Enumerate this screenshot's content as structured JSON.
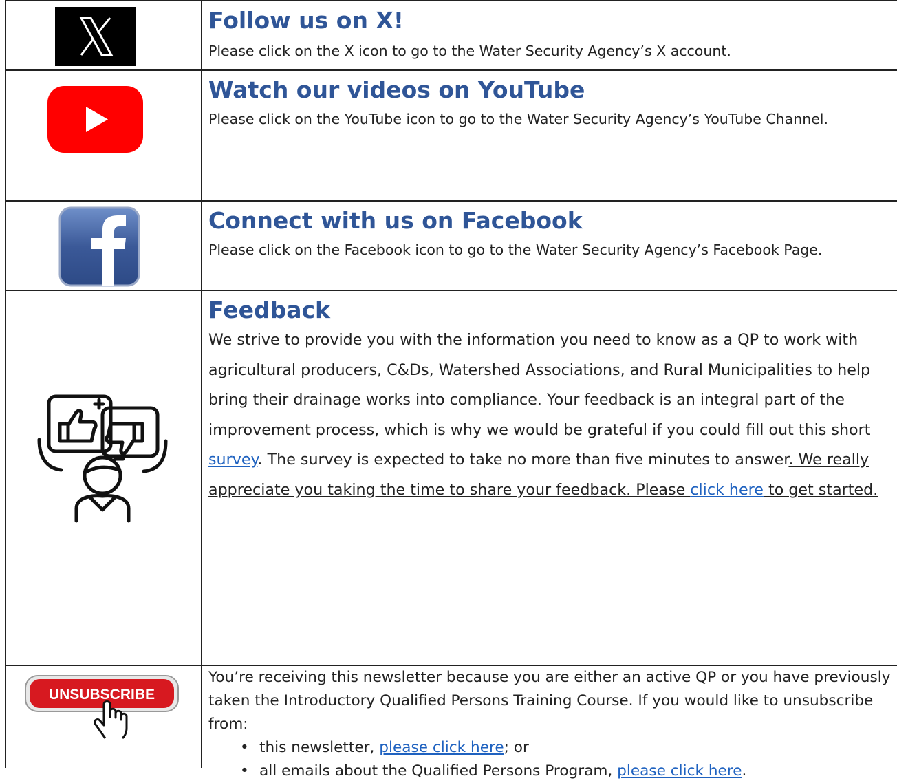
{
  "rows": {
    "x": {
      "icon": "x-logo-icon",
      "heading": "Follow us on X!",
      "text": "Please click on the X icon to go to the Water Security Agency’s X account."
    },
    "youtube": {
      "icon": "youtube-logo-icon",
      "heading": "Watch our videos on YouTube",
      "text": "Please click on the YouTube icon to go to the Water Security Agency’s YouTube Channel."
    },
    "facebook": {
      "icon": "facebook-logo-icon",
      "heading": "Connect with us on Facebook",
      "text": "Please click on the Facebook icon to go to the Water Security Agency’s Facebook Page."
    },
    "feedback": {
      "icon": "feedback-thumbs-icon",
      "heading": "Feedback",
      "text_1": "We strive to provide you with the information you need to know as a QP to work with agricultural producers, C&Ds, Watershed Associations, and Rural Municipalities to help bring their drainage works into compliance. Your feedback is an integral part of the improvement process, which is why we would be grateful if you could fill out this short ",
      "survey_link": "survey",
      "text_2": ". The survey is expected to take no more than five minutes to answer",
      "text_3": ". We really appreciate you taking the time to share your feedback. Please ",
      "click_here_link": "click here",
      "text_4": " to get started."
    },
    "unsubscribe": {
      "icon": "unsubscribe-button-icon",
      "badge_label": "UNSUBSCRIBE",
      "intro": "You’re receiving this newsletter because you are either an active QP or you have previously taken the Introductory Qualified Persons Training Course. If you would like to unsubscribe from:",
      "item_1_prefix": "this newsletter, ",
      "item_1_link": "please click here",
      "item_1_suffix": "; or",
      "item_2_prefix": "all emails about the Qualified Persons Program, ",
      "item_2_link": "please click here",
      "item_2_suffix": "."
    }
  },
  "colors": {
    "heading": "#2f5597",
    "link": "#1f62c0",
    "youtube_red": "#ff0000",
    "facebook_blue": "#3b5998",
    "unsubscribe_red": "#d71920"
  }
}
